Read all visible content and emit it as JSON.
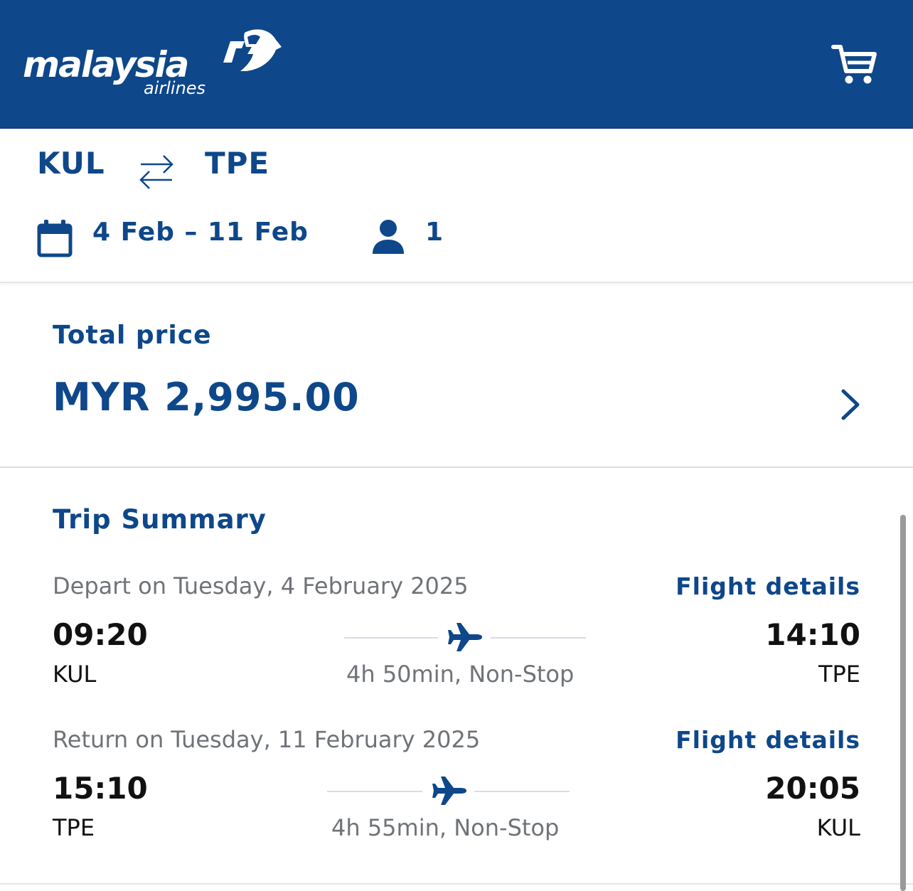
{
  "header": {
    "logo_text": "malaysia",
    "logo_subtext": "airlines",
    "colors": {
      "brand": "#0e478a",
      "background": "#ffffff"
    },
    "cart_icon": "cart-icon"
  },
  "route": {
    "origin": "KUL",
    "destination": "TPE",
    "swap_icon": "swap-arrows-icon",
    "dates": "4 Feb – 11 Feb",
    "calendar_icon": "calendar-icon",
    "passengers": "1",
    "passenger_icon": "person-icon"
  },
  "price": {
    "label": "Total price",
    "value": "MYR 2,995.00",
    "chevron_icon": "chevron-right-icon"
  },
  "summary": {
    "title": "Trip Summary",
    "legs": [
      {
        "heading": "Depart on Tuesday, 4 February 2025",
        "details_label": "Flight details",
        "depart_time": "09:20",
        "depart_code": "KUL",
        "arrive_time": "14:10",
        "arrive_code": "TPE",
        "duration": "4h 50min, Non-Stop"
      },
      {
        "heading": "Return on Tuesday, 11 February 2025",
        "details_label": "Flight details",
        "depart_time": "15:10",
        "depart_code": "TPE",
        "arrive_time": "20:05",
        "arrive_code": "KUL",
        "duration": "4h 55min, Non-Stop"
      }
    ]
  }
}
